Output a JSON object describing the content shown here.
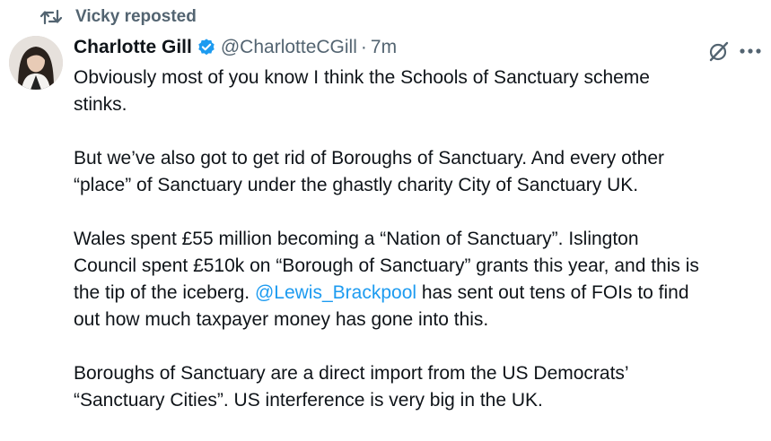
{
  "repost": {
    "label": "Vicky reposted",
    "icon": "repost-icon"
  },
  "author": {
    "name": "Charlotte Gill",
    "handle": "@CharlotteCGill",
    "separator": "·",
    "time": "7m",
    "verified_color": "#1d9bf0"
  },
  "actions": {
    "grok_icon": "grok-icon",
    "more_icon": "more-options-icon"
  },
  "tweet": {
    "p1": {
      "l1": "Obviously most of you know I think the Schools of Sanctuary scheme",
      "l2": "stinks."
    },
    "p2": {
      "l1": "But we’ve also got to get rid of Boroughs of Sanctuary. And every other",
      "l2": "“place” of Sanctuary under the ghastly charity City of Sanctuary UK."
    },
    "p3": {
      "l1": "Wales spent £55 million becoming a “Nation of Sanctuary”. Islington",
      "l2": "Council spent £510k on “Borough of Sanctuary” grants this year, and this is",
      "l3_a": "the tip of the iceberg. ",
      "l3_mention": "@Lewis_Brackpool",
      "l3_b": " has sent out tens of FOIs to find",
      "l4": "out how much taxpayer money has gone into this."
    },
    "p4": {
      "l1": "Boroughs of Sanctuary are a direct import from the US Democrats’",
      "l2": "“Sanctuary Cities”. US interference is very big in the UK."
    }
  },
  "colors": {
    "text": "#0f1419",
    "muted": "#536471",
    "link": "#1d9bf0"
  }
}
